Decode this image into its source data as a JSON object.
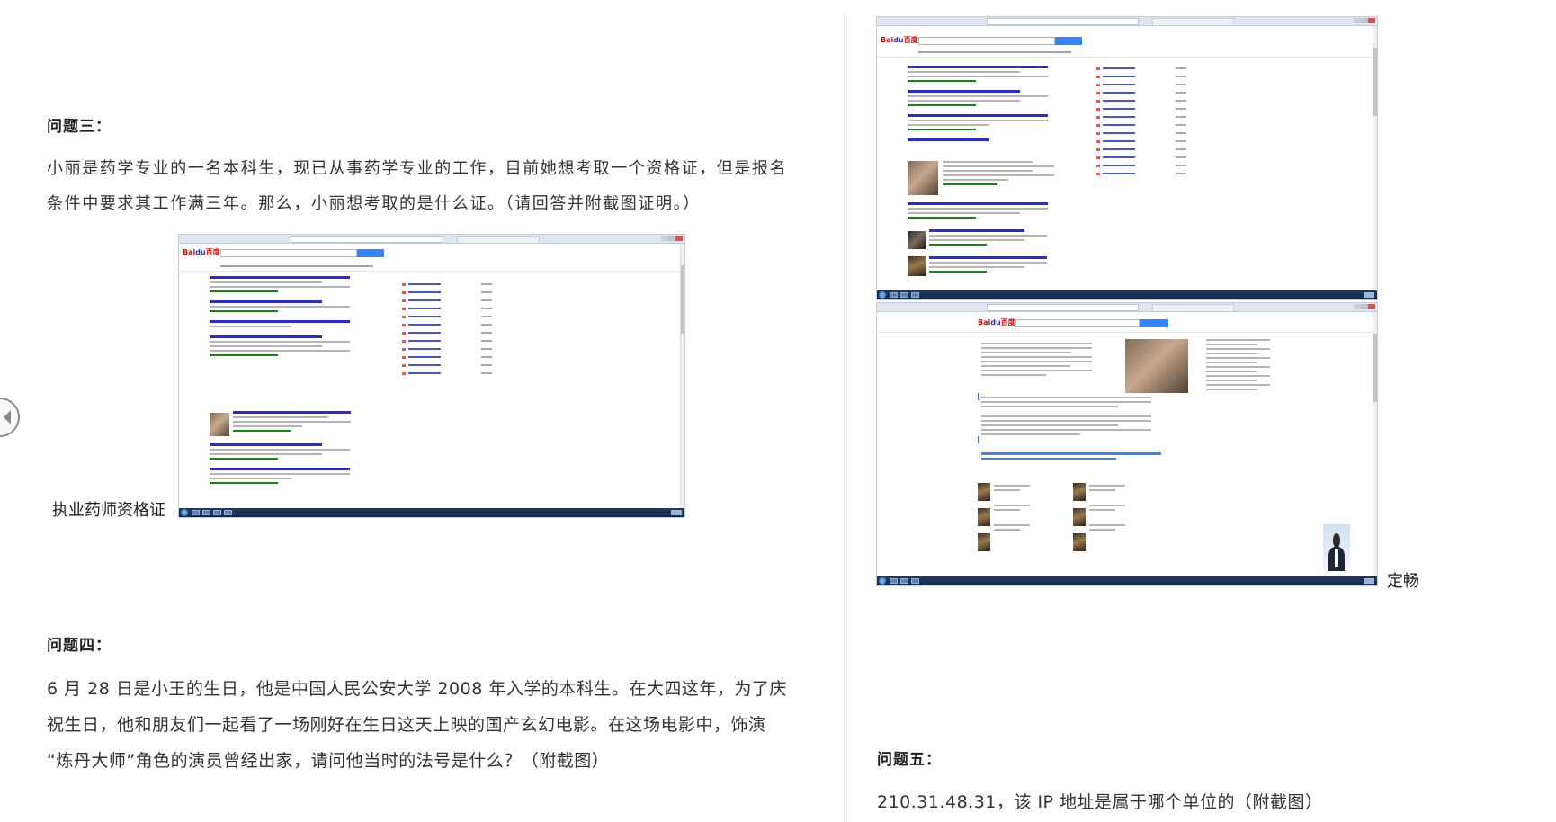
{
  "left": {
    "q3": {
      "heading": "问题三：",
      "line1": "小丽是药学专业的一名本科生，现已从事药学专业的工作，目前她想考取一个资格证，但是报名",
      "line2": "条件中要求其工作满三年。那么，小丽想考取的是什么证。（请回答并附截图证明。）",
      "answer": "执业药师资格证"
    },
    "q4": {
      "heading": "问题四：",
      "line1": "6 月 28 日是小王的生日，他是中国人民公安大学 2008 年入学的本科生。在大四这年，为了庆",
      "line2": "祝生日，他和朋友们一起看了一场刚好在生日这天上映的国产玄幻电影。在这场电影中，饰演",
      "line3": "“炼丹大师”角色的演员曾经出家，请问他当时的法号是什么？（附截图）"
    }
  },
  "right": {
    "q4_answer": "定畅",
    "q5": {
      "heading": "问题五：",
      "line1": "210.31.48.31，该 IP 地址是属于哪个单位的（附截图）"
    }
  },
  "colors": {
    "baidu_red": "#e10602",
    "baidu_blue": "#2932e1",
    "search_button": "#3385ff",
    "link_blue": "#2a2ad4",
    "url_green": "#0f8a0f",
    "taskbar": "#1f3b62"
  },
  "icons": {
    "prev": "chevron-left-circle-icon",
    "search_engine_logo": "baidu-logo"
  },
  "screenshots": {
    "logo_text_1": "Bai",
    "logo_text_2": "du",
    "logo_text_3": "百度"
  }
}
